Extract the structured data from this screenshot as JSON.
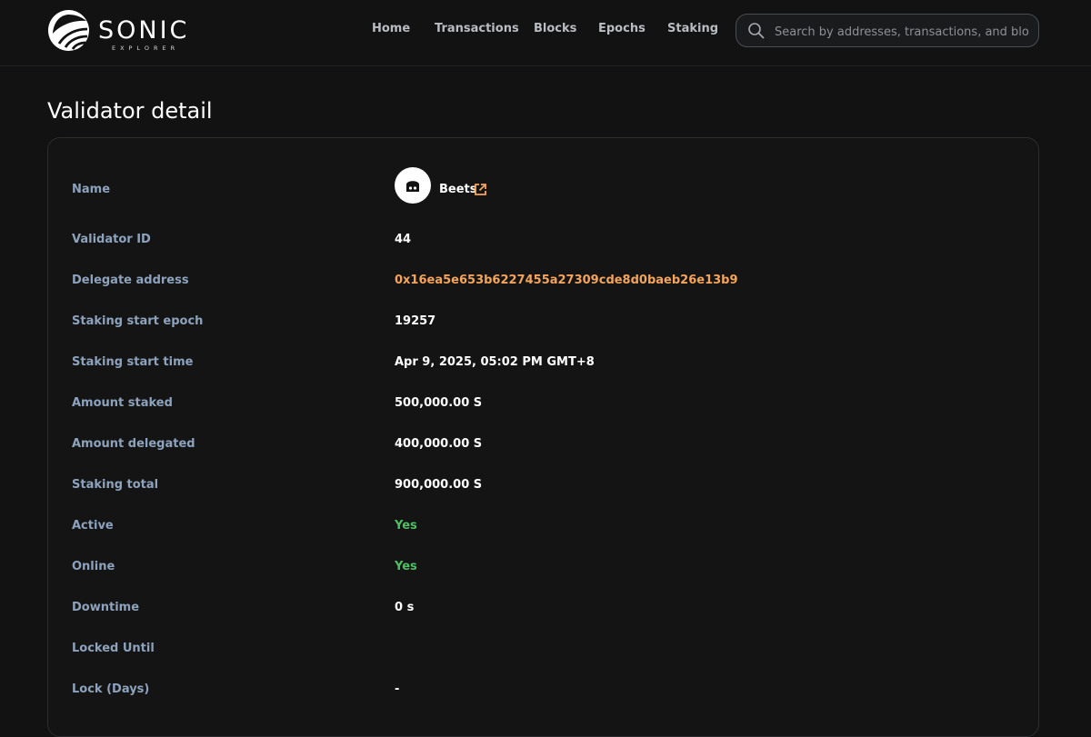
{
  "brand": {
    "name": "SONIC",
    "subtitle": "EXPLORER"
  },
  "nav": {
    "items": [
      "Home",
      "Transactions",
      "Blocks",
      "Epochs",
      "Staking"
    ]
  },
  "search": {
    "placeholder": "Search by addresses, transactions, and blocks",
    "value": ""
  },
  "page": {
    "title": "Validator detail"
  },
  "details": {
    "name": {
      "label": "Name",
      "value": "Beets"
    },
    "validator_id": {
      "label": "Validator ID",
      "value": "44"
    },
    "delegate_address": {
      "label": "Delegate address",
      "value": "0x16ea5e653b6227455a27309cde8d0baeb26e13b9"
    },
    "staking_start_epoch": {
      "label": "Staking start epoch",
      "value": "19257"
    },
    "staking_start_time": {
      "label": "Staking start time",
      "value": "Apr 9, 2025, 05:02 PM GMT+8"
    },
    "amount_staked": {
      "label": "Amount staked",
      "value": "500,000.00 S"
    },
    "amount_delegated": {
      "label": "Amount delegated",
      "value": "400,000.00 S"
    },
    "staking_total": {
      "label": "Staking total",
      "value": "900,000.00 S"
    },
    "active": {
      "label": "Active",
      "value": "Yes"
    },
    "online": {
      "label": "Online",
      "value": "Yes"
    },
    "downtime": {
      "label": "Downtime",
      "value": "0 s"
    },
    "locked_until": {
      "label": "Locked Until",
      "value": ""
    },
    "lock_days": {
      "label": "Lock (Days)",
      "value": "-"
    }
  },
  "colors": {
    "background": "#121212",
    "label": "#8da3bd",
    "link": "#f5a55b",
    "positive": "#4fbf63"
  },
  "icons": {
    "logo": "sonic-logo-icon",
    "search": "search-icon",
    "avatar": "beets-avatar-icon",
    "external": "external-link-icon"
  }
}
